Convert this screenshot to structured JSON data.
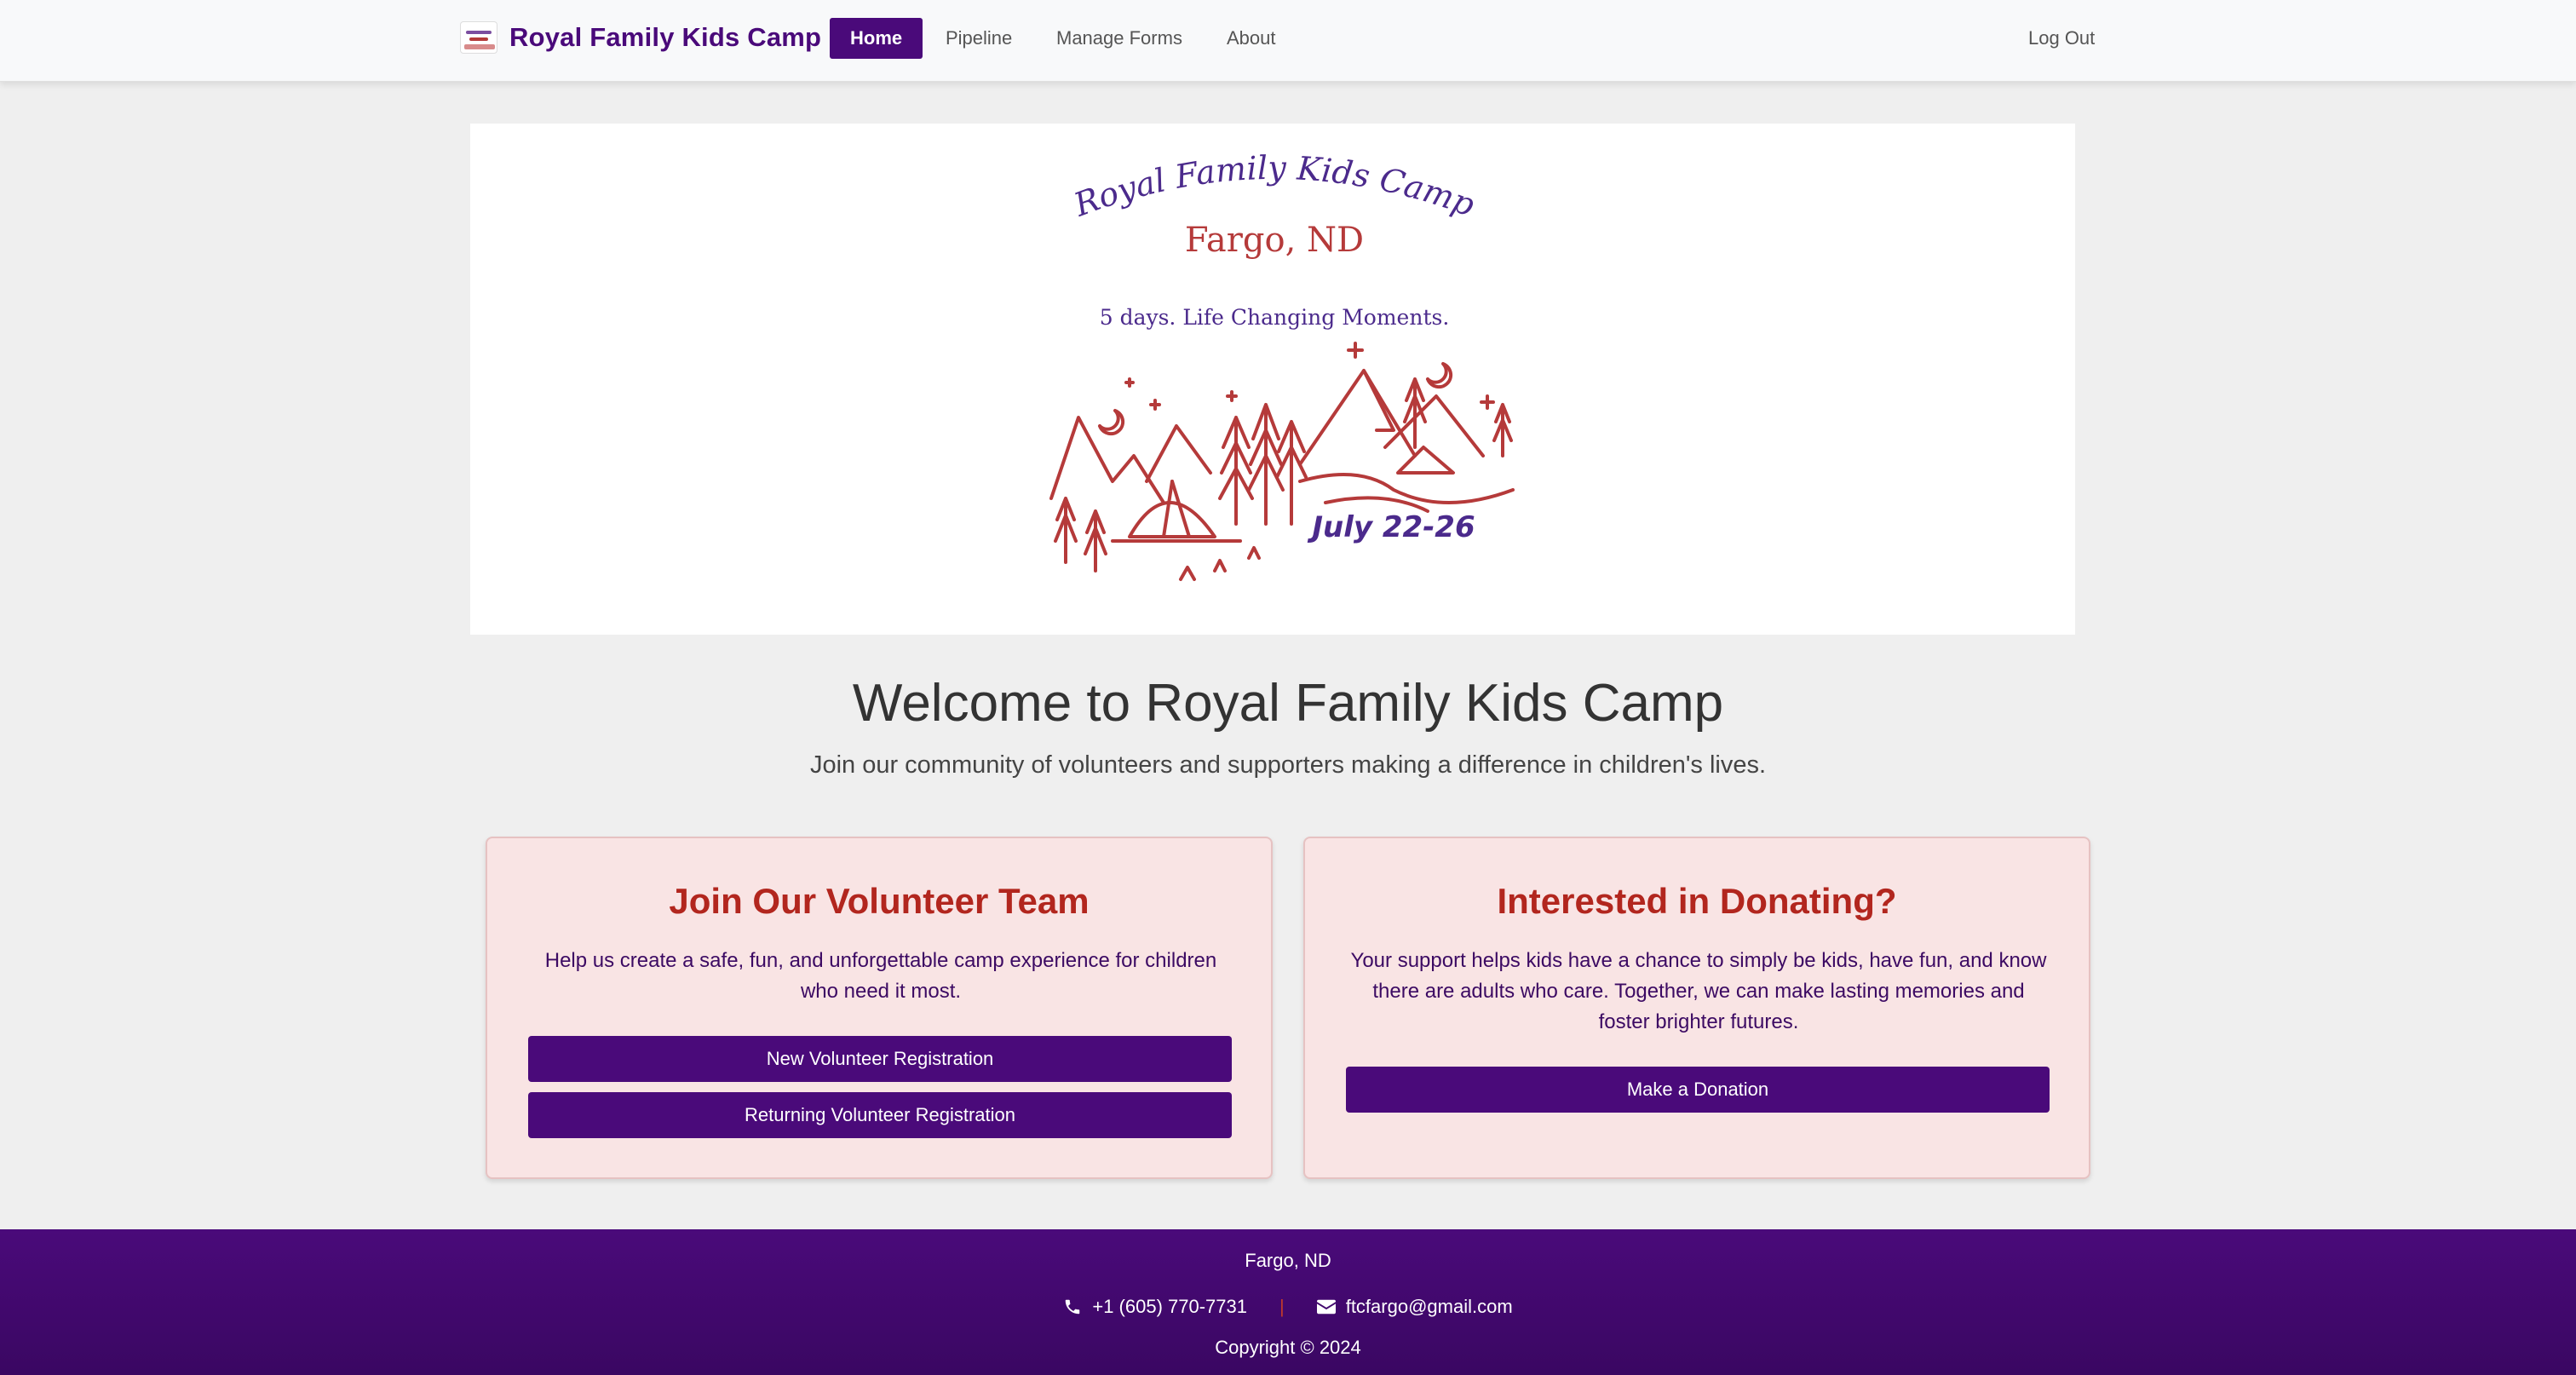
{
  "nav": {
    "brand": "Royal Family Kids Camp",
    "home": "Home",
    "pipeline": "Pipeline",
    "manage_forms": "Manage Forms",
    "about": "About",
    "logout": "Log Out"
  },
  "hero": {
    "arc_title": "Royal Family Kids Camp",
    "location": "Fargo, ND",
    "tagline": "5 days. Life Changing Moments.",
    "dates": "July 22-26"
  },
  "welcome": {
    "title": "Welcome to Royal Family Kids Camp",
    "subtitle": "Join our community of volunteers and supporters making a difference in children's lives."
  },
  "volunteer_card": {
    "title": "Join Our Volunteer Team",
    "text": "Help us create a safe, fun, and unforgettable camp experience for children who need it most.",
    "new_button": "New Volunteer Registration",
    "returning_button": "Returning Volunteer Registration"
  },
  "donate_card": {
    "title": "Interested in Donating?",
    "text": "Your support helps kids have a chance to simply be kids, have fun, and know there are adults who care. Together, we can make lasting memories and foster brighter futures.",
    "button": "Make a Donation"
  },
  "footer": {
    "city": "Fargo, ND",
    "phone": "+1 (605) 770-7731",
    "separator": "|",
    "email": "ftcfargo@gmail.com",
    "copyright": "Copyright © 2024"
  },
  "colors": {
    "brand_purple": "#4a0a7a",
    "accent_red": "#b2261e",
    "card_bg": "#f9e4e4",
    "page_bg": "#efefef"
  },
  "icons": {
    "phone": "phone-icon",
    "email": "envelope-icon"
  }
}
